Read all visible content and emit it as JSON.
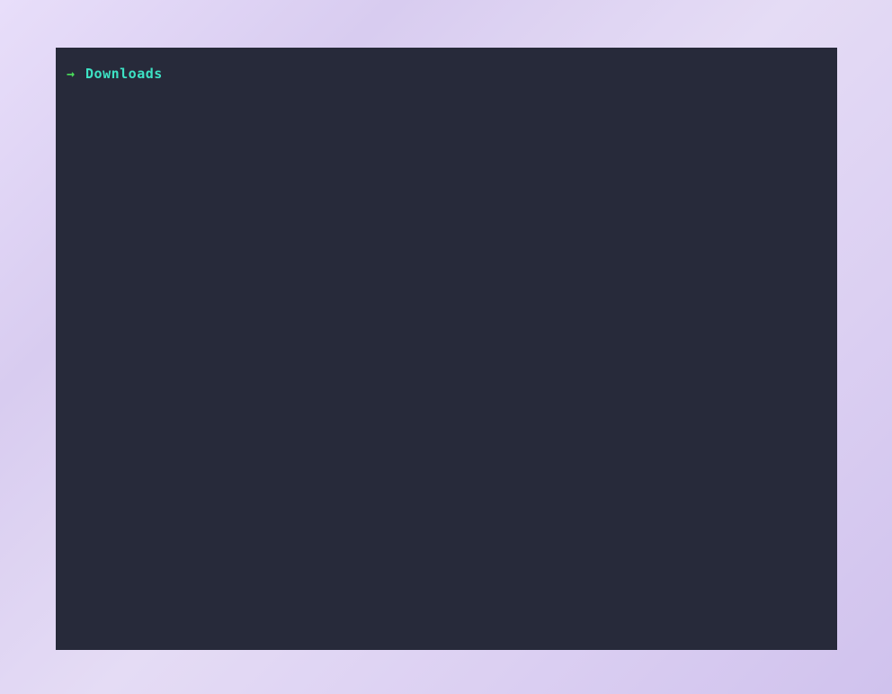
{
  "terminal": {
    "prompt": {
      "arrow": "→",
      "directory": "Downloads"
    }
  }
}
